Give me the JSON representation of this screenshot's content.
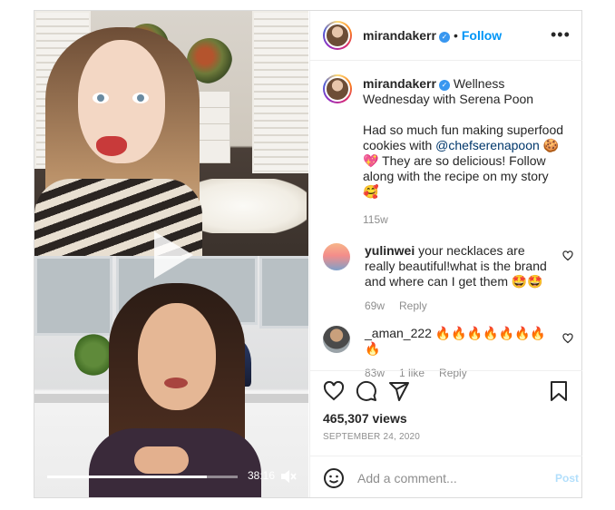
{
  "post": {
    "username": "mirandakerr",
    "follow_label": "Follow",
    "header_separator": "•",
    "more_label": "•••"
  },
  "video": {
    "time_remaining": "38:16",
    "progress": 0.84
  },
  "caption": {
    "username": "mirandakerr",
    "text_part1": "Wellness Wednesday with Serena Poon",
    "text_part2": "Had so much fun making superfood cookies with ",
    "mention": "@chefserenapoon",
    "text_part3": " 🍪",
    "text_part4": "💖 They are so delicious! Follow along with the recipe on my story",
    "text_part5": "🥰",
    "age": "115w"
  },
  "comments": [
    {
      "username": "yulinwei",
      "text": " your necklaces are really beautiful!what is the brand and where can I get them 🤩🤩",
      "age": "69w",
      "likes": "",
      "reply_label": "Reply"
    },
    {
      "username": "_aman_222",
      "text": " 🔥🔥🔥🔥🔥🔥🔥🔥",
      "age": "83w",
      "likes": "1 like",
      "reply_label": "Reply"
    }
  ],
  "stats": {
    "views": "465,307 views",
    "date": "SEPTEMBER 24, 2020"
  },
  "composer": {
    "placeholder": "Add a comment...",
    "post_label": "Post"
  },
  "colors": {
    "link": "#0095f6",
    "muted": "#8e8e8e",
    "mention": "#00376b"
  },
  "icons": [
    "play-icon",
    "mute-icon",
    "verified-badge-icon",
    "more-icon",
    "heart-icon",
    "comment-icon",
    "share-icon",
    "bookmark-icon",
    "emoji-icon"
  ]
}
